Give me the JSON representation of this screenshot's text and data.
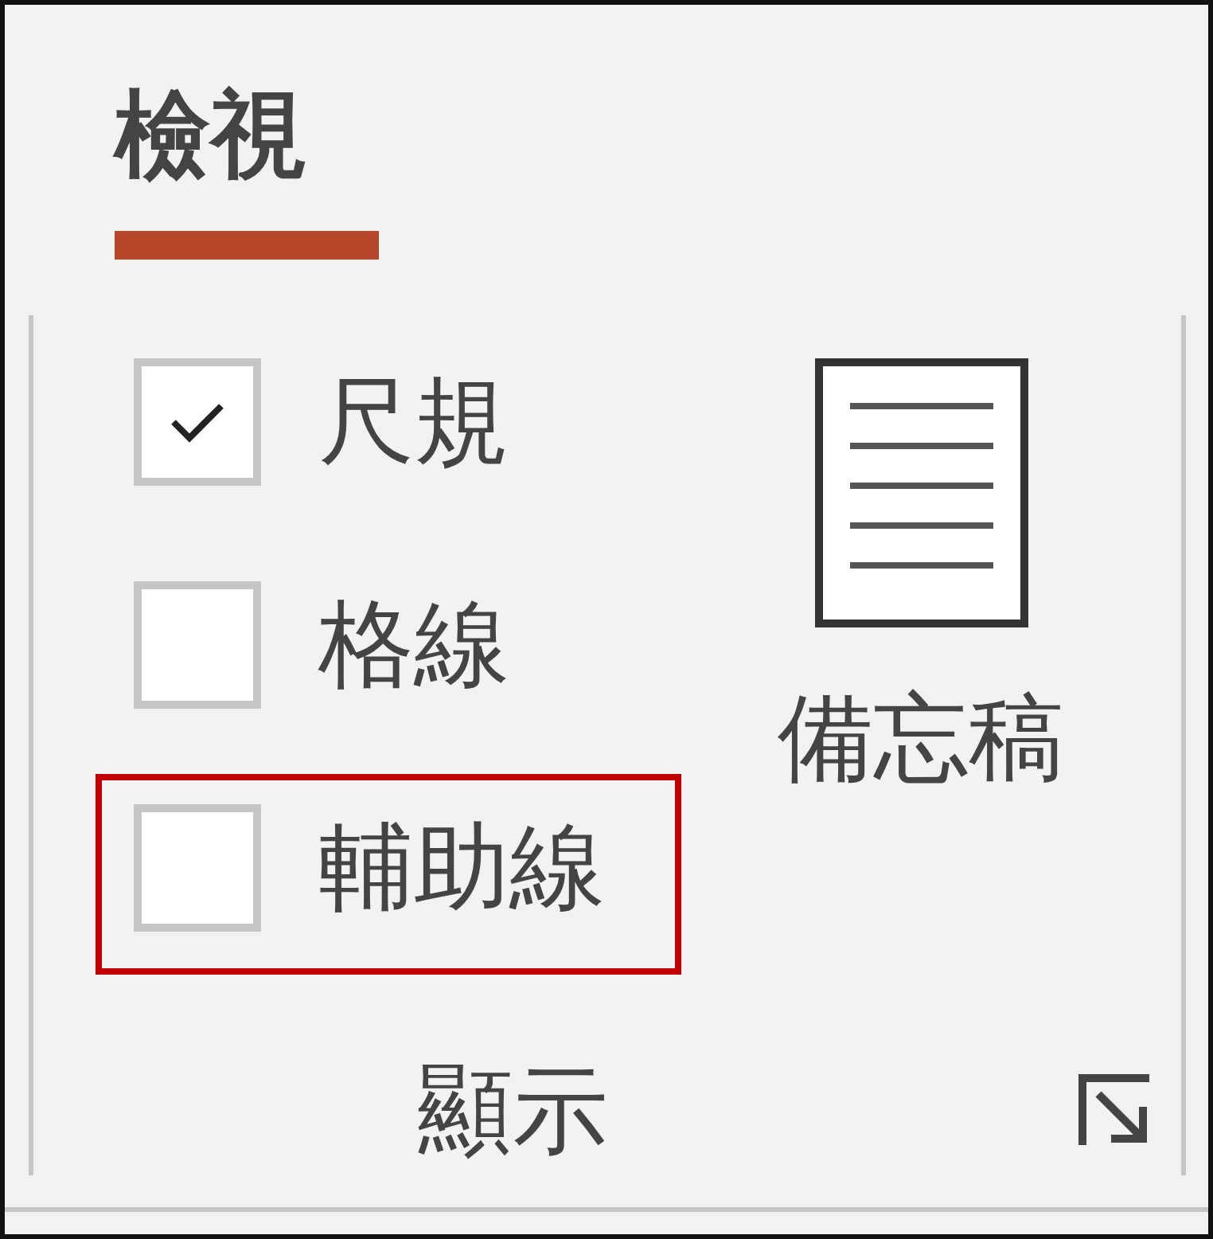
{
  "tab": {
    "label": "檢視",
    "selected": true
  },
  "group": {
    "label": "顯示",
    "checkboxes": [
      {
        "label": "尺規",
        "checked": true,
        "highlighted": false
      },
      {
        "label": "格線",
        "checked": false,
        "highlighted": false
      },
      {
        "label": "輔助線",
        "checked": false,
        "highlighted": true
      }
    ],
    "notes_button": {
      "label": "備忘稿"
    }
  }
}
